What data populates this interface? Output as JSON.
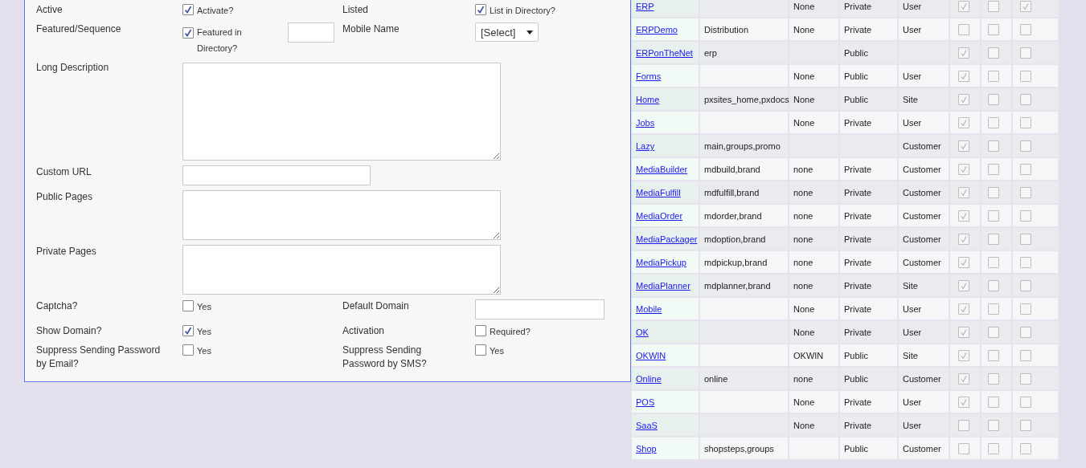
{
  "form": {
    "rows": [
      {
        "fields": [
          {
            "label": "Active",
            "kind": "checkbox",
            "option": "Activate?",
            "checked": true
          },
          {
            "label": "Listed",
            "kind": "checkbox",
            "option": "List in Directory?",
            "checked": true
          }
        ]
      },
      {
        "fields": [
          {
            "label": "Featured/Sequence",
            "kind": "checkbox_number",
            "option": "Featured in Directory?",
            "checked": true
          },
          {
            "label": "Mobile Name",
            "kind": "select",
            "value": "[Select]"
          }
        ]
      },
      {
        "fields": [
          {
            "label": "Long Description",
            "kind": "textarea_large"
          }
        ]
      },
      {
        "fields": [
          {
            "label": "Custom URL",
            "kind": "text"
          }
        ]
      },
      {
        "fields": [
          {
            "label": "Public Pages",
            "kind": "textarea"
          }
        ]
      },
      {
        "fields": [
          {
            "label": "Private Pages",
            "kind": "textarea"
          }
        ]
      },
      {
        "fields": [
          {
            "label": "Captcha?",
            "kind": "checkbox",
            "option": "Yes",
            "checked": false
          },
          {
            "label": "Default Domain",
            "kind": "text"
          }
        ]
      },
      {
        "fields": [
          {
            "label": "Show Domain?",
            "kind": "checkbox",
            "option": "Yes",
            "checked": true
          },
          {
            "label": "Activation",
            "kind": "checkbox",
            "option": "Required?",
            "checked": false
          }
        ]
      },
      {
        "fields": [
          {
            "label": "Suppress Sending Password by Email?",
            "kind": "checkbox",
            "option": "Yes",
            "checked": false
          },
          {
            "label": "Suppress Sending Password by SMS?",
            "kind": "checkbox",
            "option": "Yes",
            "checked": false
          }
        ]
      }
    ]
  },
  "table": {
    "rows": [
      {
        "name": "ERP",
        "column_3": "None",
        "column_4": "Private",
        "column_5": "User",
        "flags": [
          true,
          false,
          true
        ]
      },
      {
        "name": "ERPDemo",
        "column_2": "Distribution",
        "column_3": "None",
        "column_4": "Private",
        "column_5": "User",
        "flags": [
          false,
          false,
          false
        ]
      },
      {
        "name": "ERPonTheNet",
        "column_2": "erp",
        "column_4": "Public",
        "flags": [
          true,
          false,
          false
        ]
      },
      {
        "name": "Forms",
        "column_3": "None",
        "column_4": "Public",
        "column_5": "User",
        "flags": [
          true,
          false,
          false
        ]
      },
      {
        "name": "Home",
        "column_2": "pxsites_home,pxdocs",
        "column_3": "None",
        "column_4": "Public",
        "column_5": "Site",
        "flags": [
          true,
          false,
          false
        ]
      },
      {
        "name": "Jobs",
        "column_3": "None",
        "column_4": "Private",
        "column_5": "User",
        "flags": [
          true,
          false,
          false
        ]
      },
      {
        "name": "Lazy",
        "column_2": "main,groups,promo",
        "column_5": "Customer",
        "flags": [
          true,
          false,
          false
        ]
      },
      {
        "name": "MediaBuilder",
        "column_2": "mdbuild,brand",
        "column_3": "none",
        "column_4": "Private",
        "column_5": "Customer",
        "flags": [
          true,
          false,
          false
        ]
      },
      {
        "name": "MediaFulfill",
        "column_2": "mdfulfill,brand",
        "column_3": "none",
        "column_4": "Private",
        "column_5": "Customer",
        "flags": [
          true,
          false,
          false
        ]
      },
      {
        "name": "MediaOrder",
        "column_2": "mdorder,brand",
        "column_3": "none",
        "column_4": "Private",
        "column_5": "Customer",
        "flags": [
          true,
          false,
          false
        ]
      },
      {
        "name": "MediaPackager",
        "column_2": "mdoption,brand",
        "column_3": "none",
        "column_4": "Private",
        "column_5": "Customer",
        "flags": [
          true,
          false,
          false
        ]
      },
      {
        "name": "MediaPickup",
        "column_2": "mdpickup,brand",
        "column_3": "none",
        "column_4": "Private",
        "column_5": "Customer",
        "flags": [
          true,
          false,
          false
        ]
      },
      {
        "name": "MediaPlanner",
        "column_2": "mdplanner,brand",
        "column_3": "none",
        "column_4": "Private",
        "column_5": "Site",
        "flags": [
          true,
          false,
          false
        ]
      },
      {
        "name": "Mobile",
        "column_3": "None",
        "column_4": "Private",
        "column_5": "User",
        "flags": [
          true,
          false,
          false
        ]
      },
      {
        "name": "OK",
        "column_3": "None",
        "column_4": "Private",
        "column_5": "User",
        "flags": [
          true,
          false,
          false
        ]
      },
      {
        "name": "OKWIN",
        "column_3": "OKWIN",
        "column_4": "Public",
        "column_5": "Site",
        "flags": [
          true,
          false,
          false
        ]
      },
      {
        "name": "Online",
        "column_2": "online",
        "column_3": "none",
        "column_4": "Public",
        "column_5": "Customer",
        "flags": [
          true,
          false,
          false
        ]
      },
      {
        "name": "POS",
        "column_3": "None",
        "column_4": "Private",
        "column_5": "User",
        "flags": [
          true,
          false,
          false
        ]
      },
      {
        "name": "SaaS",
        "column_3": "None",
        "column_4": "Private",
        "column_5": "User",
        "flags": [
          false,
          false,
          false
        ]
      },
      {
        "name": "Shop",
        "column_2": "shopsteps,groups",
        "column_4": "Public",
        "column_5": "Customer",
        "flags": [
          false,
          false,
          false
        ]
      }
    ]
  }
}
